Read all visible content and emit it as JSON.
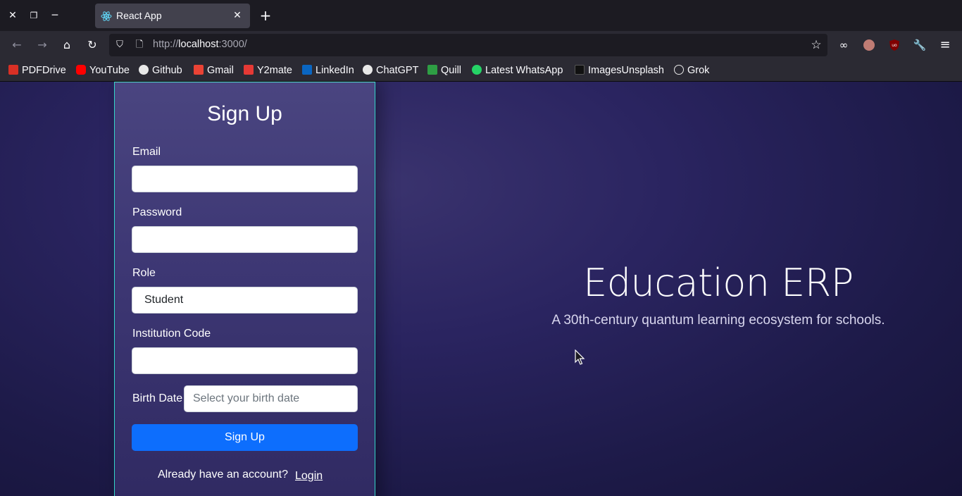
{
  "browser": {
    "tab": {
      "title": "React App"
    },
    "url": {
      "proto": "http://",
      "host": "localhost",
      "rest": ":3000/"
    },
    "bookmarks": [
      {
        "label": "PDFDrive",
        "color": "#d93025"
      },
      {
        "label": "YouTube",
        "color": "#ff0000"
      },
      {
        "label": "Github",
        "color": "#e8e8e8"
      },
      {
        "label": "Gmail",
        "color": "#ea4335"
      },
      {
        "label": "Y2mate",
        "color": "#e53935"
      },
      {
        "label": "LinkedIn",
        "color": "#0a66c2"
      },
      {
        "label": "ChatGPT",
        "color": "#e8e8e8"
      },
      {
        "label": "Quill",
        "color": "#2e9e44"
      },
      {
        "label": "Latest WhatsApp",
        "color": "#25d366"
      },
      {
        "label": "ImagesUnsplash",
        "color": "#111111"
      },
      {
        "label": "Grok",
        "color": "#e8e8e8"
      }
    ]
  },
  "form": {
    "title": "Sign Up",
    "email_label": "Email",
    "email_value": "",
    "password_label": "Password",
    "password_value": "",
    "role_label": "Role",
    "role_value": "Student",
    "institution_label": "Institution Code",
    "institution_value": "",
    "birth_label": "Birth Date",
    "birth_placeholder": "Select your birth date",
    "submit_label": "Sign Up",
    "footer_text": "Already have an account?",
    "login_label": "Login"
  },
  "hero": {
    "title": "Education ERP",
    "subtitle": "A 30th-century quantum learning ecosystem for schools."
  },
  "colors": {
    "accent": "#0d6efd",
    "card_border": "#33d6c9",
    "page_bg": "#2a2460"
  }
}
